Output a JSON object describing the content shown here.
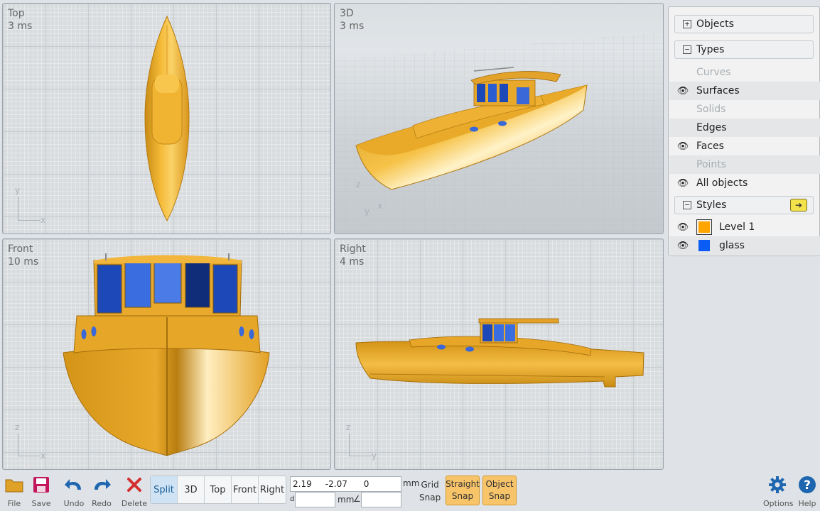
{
  "viewports": {
    "top": {
      "label": "Top",
      "ms": "3 ms",
      "axis_v": "y",
      "axis_h": "x"
    },
    "threed": {
      "label": "3D",
      "ms": "3 ms",
      "axis_v": "z",
      "axis_h": "x",
      "axis_d": "y"
    },
    "front": {
      "label": "Front",
      "ms": "10 ms",
      "axis_v": "z",
      "axis_h": "x"
    },
    "right": {
      "label": "Right",
      "ms": "4 ms",
      "axis_v": "z",
      "axis_h": "y"
    }
  },
  "panel": {
    "objects_title": "Objects",
    "types_title": "Types",
    "types": [
      {
        "label": "Curves",
        "visible": false,
        "enabled": false
      },
      {
        "label": "Surfaces",
        "visible": true,
        "enabled": true
      },
      {
        "label": "Solids",
        "visible": false,
        "enabled": false
      },
      {
        "label": "Edges",
        "visible": false,
        "enabled": true
      },
      {
        "label": "Faces",
        "visible": true,
        "enabled": true
      },
      {
        "label": "Points",
        "visible": false,
        "enabled": false
      },
      {
        "label": "All objects",
        "visible": true,
        "enabled": true
      }
    ],
    "styles_title": "Styles",
    "styles": [
      {
        "label": "Level 1",
        "color": "#ffa500"
      },
      {
        "label": "glass",
        "color": "#0a5cf5"
      }
    ]
  },
  "toolbar": {
    "file": "File",
    "save": "Save",
    "undo": "Undo",
    "redo": "Redo",
    "delete": "Delete",
    "views": [
      "Split",
      "3D",
      "Top",
      "Front",
      "Right"
    ],
    "active_view": "Split",
    "coords": "2.19     -2.07      0",
    "unit_mm": "mm",
    "distance_label": "d",
    "angle_label": "∠",
    "grid_snap": [
      "Grid",
      "Snap"
    ],
    "straight_snap": [
      "Straight",
      "Snap"
    ],
    "object_snap": [
      "Object",
      "Snap"
    ],
    "options": "Options",
    "help": "Help"
  },
  "colors": {
    "hull": "#f2b230",
    "hull_light": "#ffe9a8",
    "hull_dark": "#b97d10",
    "glass": "#1d49b8",
    "accent_snap": "#f7c46a"
  }
}
